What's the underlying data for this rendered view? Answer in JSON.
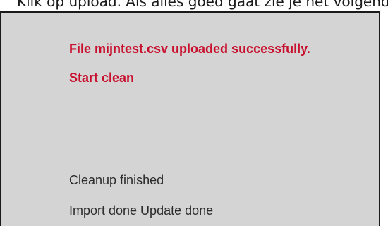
{
  "caption": "Klik op upload. Als alles goed gaat zie je het volgende:",
  "panel": {
    "messages": [
      {
        "text": "File mijntest.csv uploaded successfully.",
        "style": "error"
      },
      {
        "text": "Start clean",
        "style": "error"
      },
      {
        "text": "Cleanup finished",
        "style": "normal"
      },
      {
        "text": "Import done Update done",
        "style": "normal"
      }
    ],
    "colors": {
      "accent_red": "#c8102e",
      "panel_bg": "#d4d4d4",
      "text": "#2b2b2b"
    }
  }
}
